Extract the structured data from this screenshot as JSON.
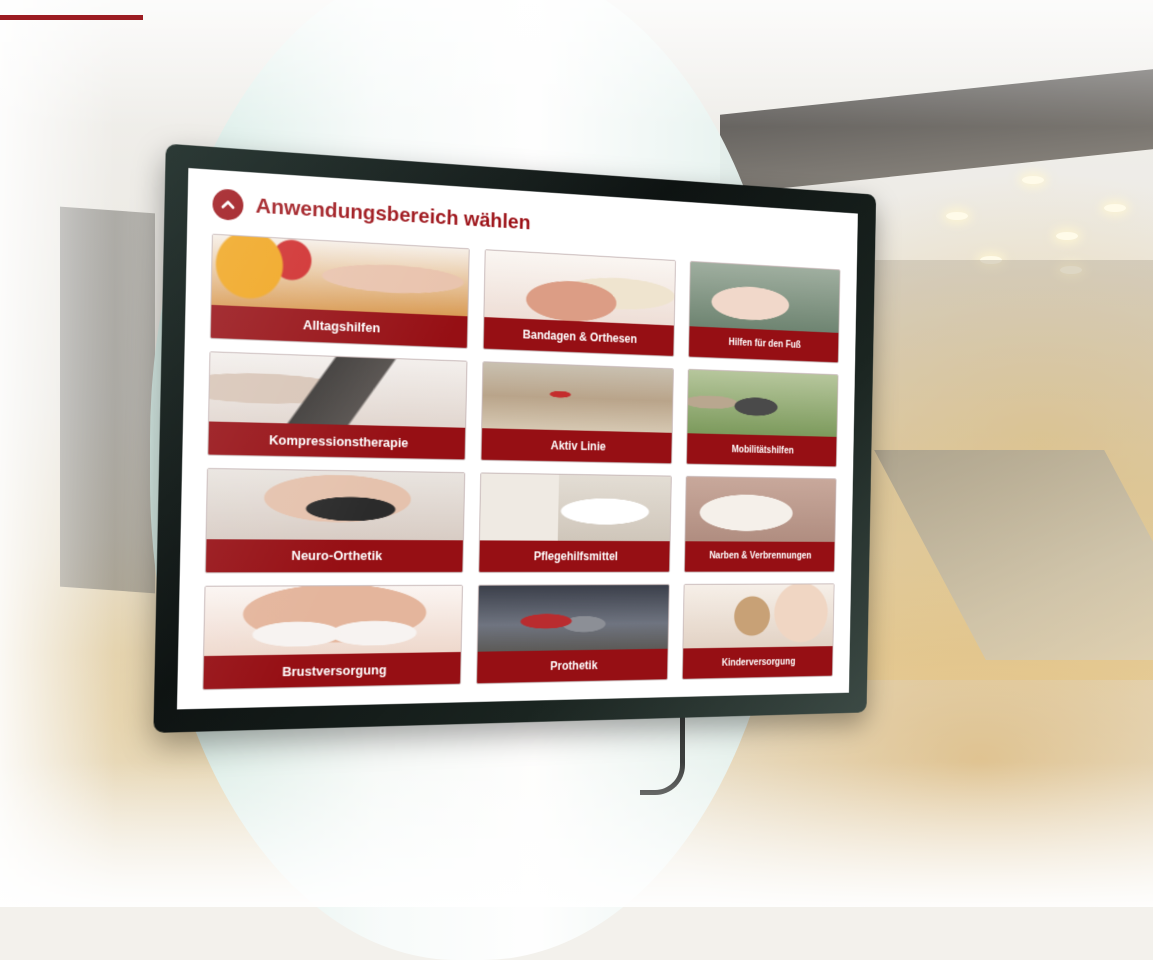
{
  "screen": {
    "title": "Anwendungsbereich wählen",
    "collapse_icon": "chevron-up-icon",
    "accent_color": "#960f14"
  },
  "tiles": [
    {
      "label": "Alltagshilfen"
    },
    {
      "label": "Bandagen & Orthesen"
    },
    {
      "label": "Hilfen für den Fuß"
    },
    {
      "label": "Kompressionstherapie"
    },
    {
      "label": "Aktiv Linie"
    },
    {
      "label": "Mobilitätshilfen"
    },
    {
      "label": "Neuro-Orthetik"
    },
    {
      "label": "Pflegehilfsmittel"
    },
    {
      "label": "Narben & Verbrennungen"
    },
    {
      "label": "Brustversorgung"
    },
    {
      "label": "Prothetik"
    },
    {
      "label": "Kinderversorgung"
    }
  ]
}
